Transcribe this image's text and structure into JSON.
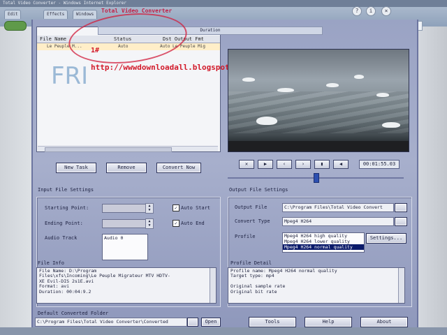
{
  "overlay": {
    "title": "Total Video Converter",
    "url": "http://wwwdownloadall.blogspot.com",
    "marker": "1#",
    "watermark": "FRI"
  },
  "browser": {
    "window_title": "Total Video Converter - Windows Internet Explorer",
    "tab1": "Edit",
    "tab2": "Effects",
    "tab3": "Windows"
  },
  "file_list": {
    "columns": [
      "File Name",
      "Status",
      "Dst Output Fmt"
    ],
    "header_col4": "Duration",
    "rows": [
      {
        "name": "Le Peuple M...",
        "status": "Auto",
        "dst": "Auto Le Peuple Mig"
      }
    ]
  },
  "buttons": {
    "new_task": "New Task",
    "remove": "Remove",
    "convert_now": "Convert Now",
    "settings": "Settings...",
    "open": "Open",
    "tools": "Tools",
    "help": "Help",
    "about": "About"
  },
  "player": {
    "time": "00:01:55.03",
    "controls": [
      "✕",
      "▶",
      "‹",
      "›",
      "▮",
      "◀",
      "▶▶"
    ]
  },
  "input_settings": {
    "title": "Input File Settings",
    "starting_point_label": "Starting Point:",
    "ending_point_label": "Ending Point:",
    "auto_start_label": "Auto Start",
    "auto_end_label": "Auto End",
    "audio_track_label": "Audio Track",
    "audio_track_value": "Audio 0",
    "file_info_label": "File Info",
    "file_info_lines": [
      "File Name:    D:\\Program",
      "Files\\xfs\\Incoming\\Le Peuple Migrateur MTV HDTV-",
      "XE Evil-DIS 2s1E.avi",
      "Format:       avi",
      "Duration:     00:04:9.2"
    ]
  },
  "output_settings": {
    "title": "Output File Settings",
    "output_file_label": "Output File",
    "output_file_value": "C:\\Program Files\\Total Video Convert",
    "convert_type_label": "Convert Type",
    "convert_type_value": "Mpeg4 H264",
    "profile_label": "Profile",
    "profiles": [
      "Mpeg4 H264 high quality",
      "Mpeg4 H264 lower quality",
      "Mpeg4 H264 normal quality"
    ],
    "profile_selected_index": 2,
    "profile_detail_label": "Profile Detail",
    "profile_detail_lines": [
      "Profile name:   Mpeg4 H264 normal quality",
      "Target type:    mp4",
      "",
      "Original sample rate",
      "Original bit rate"
    ]
  },
  "default_folder": {
    "label": "Default Converted Folder",
    "value": "C:\\Program Files\\Total Video Converter\\Converted"
  },
  "colors": {
    "app_bg": "#9aa3c4",
    "overlay_red": "#d21a2a",
    "selection": "#0a1a6a"
  }
}
